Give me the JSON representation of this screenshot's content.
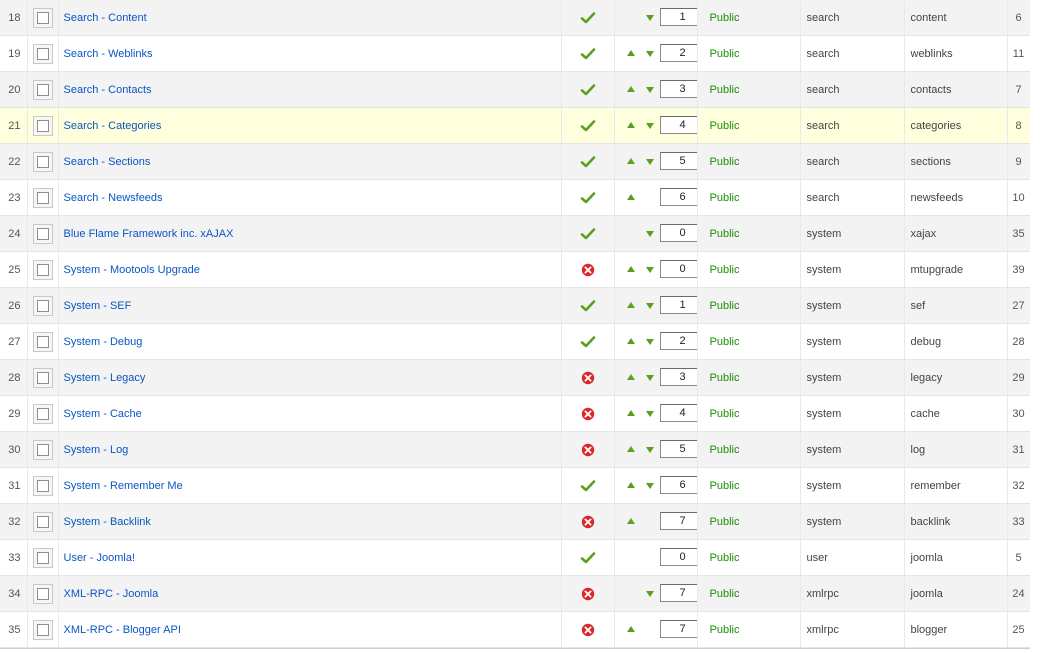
{
  "table": {
    "rows": [
      {
        "num": "18",
        "name": "Search - Content",
        "enabled": true,
        "up": false,
        "down": true,
        "order": "1",
        "access": "Public",
        "type": "search",
        "element": "content",
        "id": "6"
      },
      {
        "num": "19",
        "name": "Search - Weblinks",
        "enabled": true,
        "up": true,
        "down": true,
        "order": "2",
        "access": "Public",
        "type": "search",
        "element": "weblinks",
        "id": "11"
      },
      {
        "num": "20",
        "name": "Search - Contacts",
        "enabled": true,
        "up": true,
        "down": true,
        "order": "3",
        "access": "Public",
        "type": "search",
        "element": "contacts",
        "id": "7"
      },
      {
        "num": "21",
        "name": "Search - Categories",
        "enabled": true,
        "up": true,
        "down": true,
        "order": "4",
        "access": "Public",
        "type": "search",
        "element": "categories",
        "id": "8",
        "highlight": true
      },
      {
        "num": "22",
        "name": "Search - Sections",
        "enabled": true,
        "up": true,
        "down": true,
        "order": "5",
        "access": "Public",
        "type": "search",
        "element": "sections",
        "id": "9"
      },
      {
        "num": "23",
        "name": "Search - Newsfeeds",
        "enabled": true,
        "up": true,
        "down": false,
        "order": "6",
        "access": "Public",
        "type": "search",
        "element": "newsfeeds",
        "id": "10"
      },
      {
        "num": "24",
        "name": "Blue Flame Framework inc. xAJAX",
        "enabled": true,
        "up": false,
        "down": true,
        "order": "0",
        "access": "Public",
        "type": "system",
        "element": "xajax",
        "id": "35"
      },
      {
        "num": "25",
        "name": "System - Mootools Upgrade",
        "enabled": false,
        "up": true,
        "down": true,
        "order": "0",
        "access": "Public",
        "type": "system",
        "element": "mtupgrade",
        "id": "39"
      },
      {
        "num": "26",
        "name": "System - SEF",
        "enabled": true,
        "up": true,
        "down": true,
        "order": "1",
        "access": "Public",
        "type": "system",
        "element": "sef",
        "id": "27"
      },
      {
        "num": "27",
        "name": "System - Debug",
        "enabled": true,
        "up": true,
        "down": true,
        "order": "2",
        "access": "Public",
        "type": "system",
        "element": "debug",
        "id": "28"
      },
      {
        "num": "28",
        "name": "System - Legacy",
        "enabled": false,
        "up": true,
        "down": true,
        "order": "3",
        "access": "Public",
        "type": "system",
        "element": "legacy",
        "id": "29"
      },
      {
        "num": "29",
        "name": "System - Cache",
        "enabled": false,
        "up": true,
        "down": true,
        "order": "4",
        "access": "Public",
        "type": "system",
        "element": "cache",
        "id": "30"
      },
      {
        "num": "30",
        "name": "System - Log",
        "enabled": false,
        "up": true,
        "down": true,
        "order": "5",
        "access": "Public",
        "type": "system",
        "element": "log",
        "id": "31"
      },
      {
        "num": "31",
        "name": "System - Remember Me",
        "enabled": true,
        "up": true,
        "down": true,
        "order": "6",
        "access": "Public",
        "type": "system",
        "element": "remember",
        "id": "32"
      },
      {
        "num": "32",
        "name": "System - Backlink",
        "enabled": false,
        "up": true,
        "down": false,
        "order": "7",
        "access": "Public",
        "type": "system",
        "element": "backlink",
        "id": "33"
      },
      {
        "num": "33",
        "name": "User - Joomla!",
        "enabled": true,
        "up": false,
        "down": false,
        "order": "0",
        "access": "Public",
        "type": "user",
        "element": "joomla",
        "id": "5"
      },
      {
        "num": "34",
        "name": "XML-RPC - Joomla",
        "enabled": false,
        "up": false,
        "down": true,
        "order": "7",
        "access": "Public",
        "type": "xmlrpc",
        "element": "joomla",
        "id": "24"
      },
      {
        "num": "35",
        "name": "XML-RPC - Blogger API",
        "enabled": false,
        "up": true,
        "down": false,
        "order": "7",
        "access": "Public",
        "type": "xmlrpc",
        "element": "blogger",
        "id": "25"
      }
    ]
  },
  "colors": {
    "link": "#0b55c4",
    "access": "#1d8f05",
    "arrow": "#5aa01e",
    "enabled_icon": "#5aa01e",
    "disabled_icon": "#d9272e",
    "row_highlight": "#ffffdd"
  },
  "icons": {
    "enabled": "green-check-icon",
    "disabled": "red-x-circle-icon",
    "move_up": "arrow-up-icon",
    "move_down": "arrow-down-icon"
  }
}
